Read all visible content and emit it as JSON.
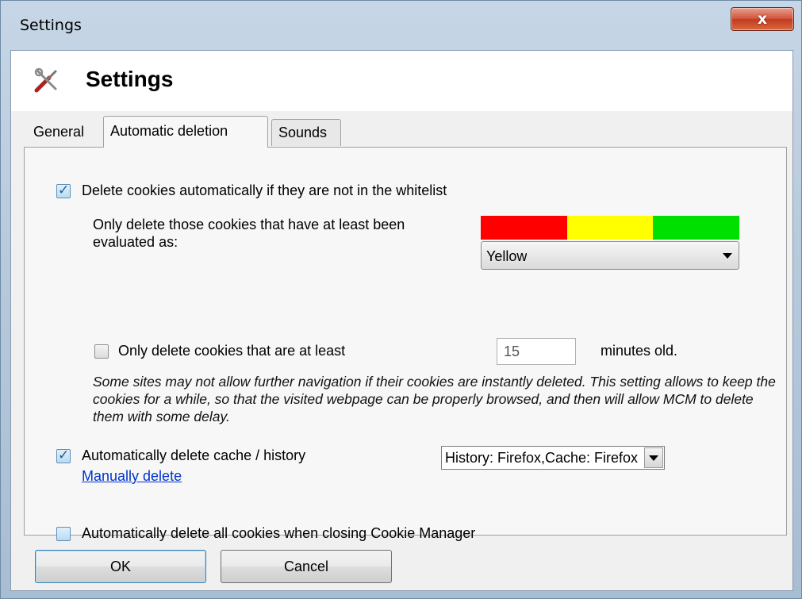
{
  "window": {
    "title": "Settings",
    "close_symbol": "x"
  },
  "header": {
    "title": "Settings",
    "icon": "tools-icon"
  },
  "tabs": [
    {
      "label": "General"
    },
    {
      "label": "Automatic deletion",
      "active": true
    },
    {
      "label": "Sounds"
    }
  ],
  "auto_delete": {
    "delete_not_whitelisted_label": "Delete cookies automatically if they are not in the whitelist",
    "delete_not_whitelisted_checked": true,
    "evaluated_label": "Only delete those cookies that have at least been evaluated as:",
    "rating_colors": [
      "#ff0000",
      "#ffff00",
      "#00e000"
    ],
    "rating_select_value": "Yellow",
    "age_label": "Only delete cookies that are at least",
    "age_checked": false,
    "age_value": "15",
    "age_unit": "minutes old.",
    "note": "Some sites may not allow further navigation if their cookies are instantly deleted. This setting allows to keep the cookies for a while, so that the visited webpage can be properly browsed, and then will allow MCM to delete them with some delay.",
    "cache_label": "Automatically delete cache / history",
    "cache_checked": true,
    "cache_select_value": "History: Firefox,Cache: Firefox",
    "manual_link": "Manually delete",
    "close_label": "Automatically delete all cookies when closing Cookie Manager",
    "close_checked": false
  },
  "buttons": {
    "ok": "OK",
    "cancel": "Cancel"
  }
}
